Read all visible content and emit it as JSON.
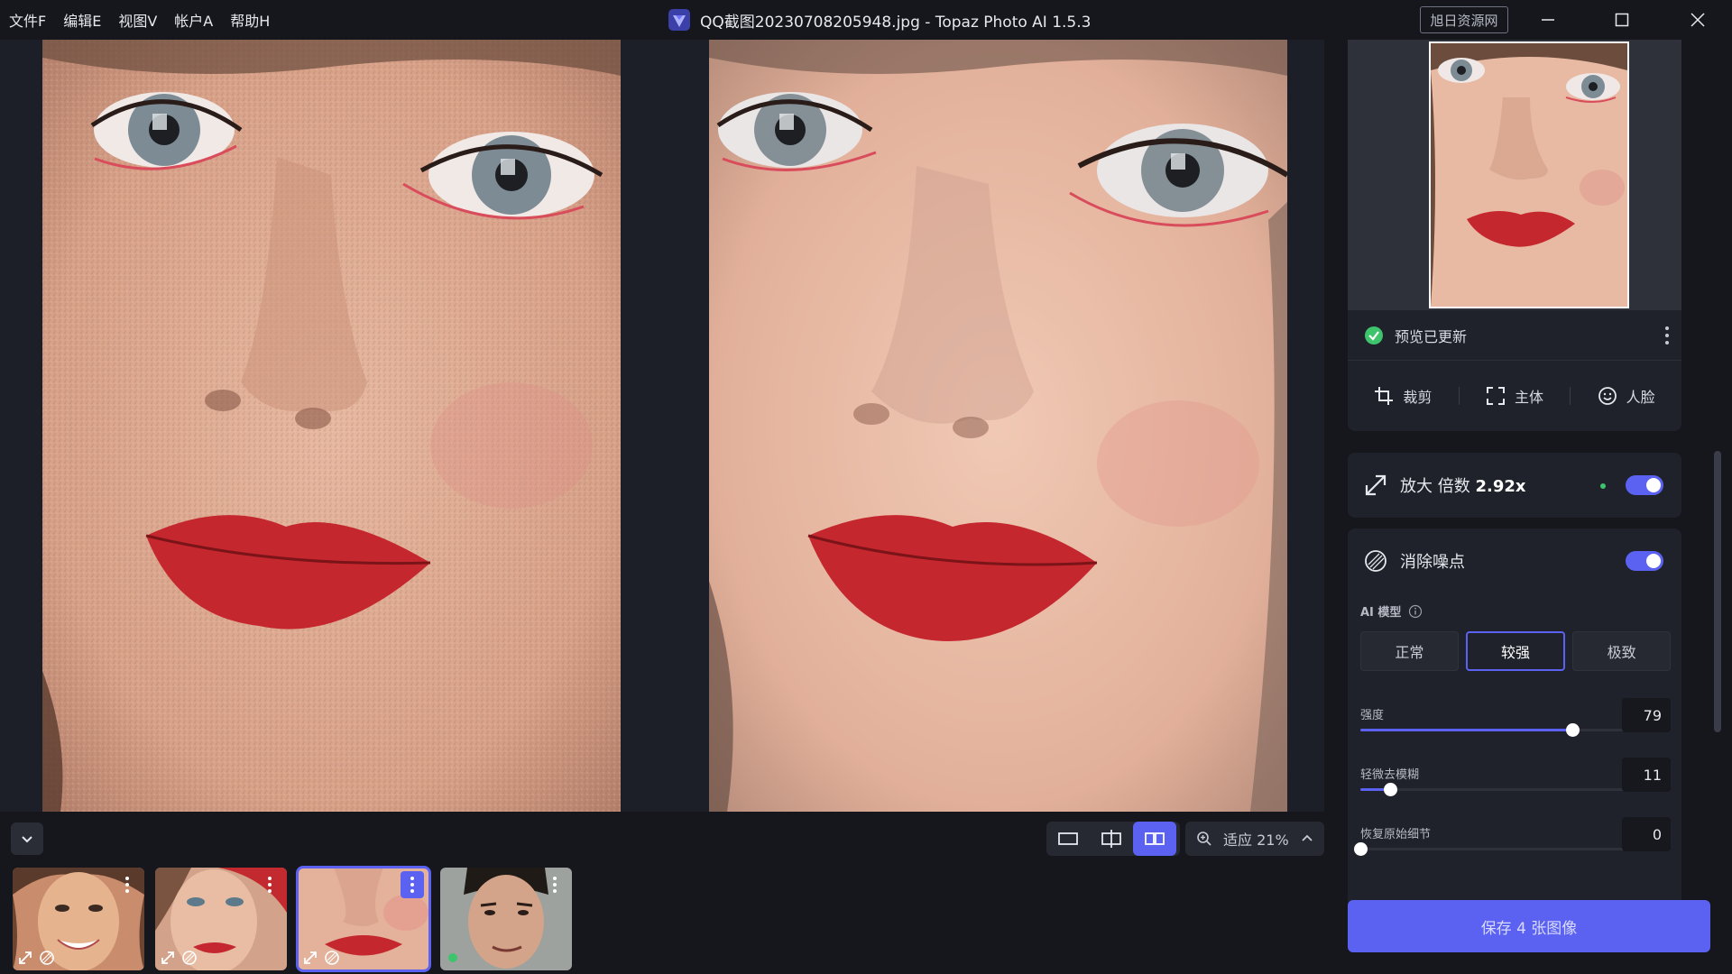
{
  "menu": [
    {
      "label": "文件F"
    },
    {
      "label": "编辑E"
    },
    {
      "label": "视图V"
    },
    {
      "label": "帐户A"
    },
    {
      "label": "帮助H"
    }
  ],
  "window": {
    "title": "QQ截图20230708205948.jpg - Topaz Photo AI 1.5.3",
    "watermark": "旭日资源网"
  },
  "bottom_bar": {
    "zoom_label": "适应 21%"
  },
  "thumbnails": [
    {
      "name": "smiling-woman",
      "selected": false
    },
    {
      "name": "woman-red-cap",
      "selected": false
    },
    {
      "name": "woman-lips-closeup",
      "selected": true
    },
    {
      "name": "man-portrait",
      "selected": false
    }
  ],
  "sidebar": {
    "status_text": "预览已更新",
    "tools": [
      {
        "label": "裁剪",
        "icon": "crop-icon"
      },
      {
        "label": "主体",
        "icon": "subject-icon"
      },
      {
        "label": "人脸",
        "icon": "face-icon"
      }
    ],
    "upscale": {
      "label": "放大 倍数",
      "factor": "2.92x",
      "enabled": true
    },
    "denoise": {
      "label": "消除噪点",
      "enabled": true,
      "ai_model_label": "AI 模型",
      "models": [
        {
          "label": "正常"
        },
        {
          "label": "较强"
        },
        {
          "label": "极致"
        }
      ],
      "selected_model": "较强",
      "sliders": [
        {
          "label": "强度",
          "value": "79",
          "fraction": 0.79
        },
        {
          "label": "轻微去模糊",
          "value": "11",
          "fraction": 0.11
        },
        {
          "label": "恢复原始细节",
          "value": "0",
          "fraction": 0.0
        }
      ]
    },
    "save_label": "保存 4 张图像"
  },
  "colors": {
    "accent": "#5b61f0",
    "status_ok": "#3ec46d",
    "background": "#15171d",
    "panel": "#1f222a"
  }
}
